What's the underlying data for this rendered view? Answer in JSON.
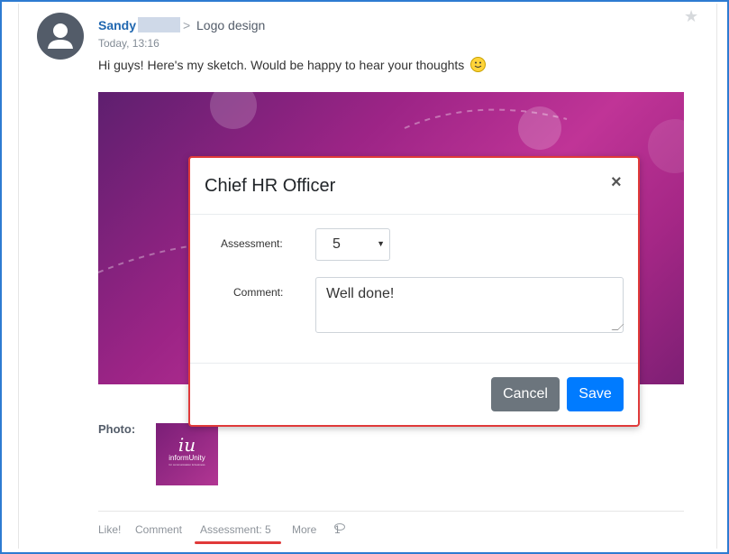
{
  "post": {
    "author": "Sandy",
    "breadcrumb_separator": ">",
    "destination": "Logo design",
    "timestamp": "Today, 13:16",
    "message": "Hi guys! Here's my sketch. Would be happy to hear your thoughts",
    "photo_label": "Photo:",
    "thumbnail": {
      "logo": "iu",
      "brand": "informUnity",
      "tagline": "for communication & business"
    }
  },
  "actions": {
    "like": "Like!",
    "comment": "Comment",
    "assessment": "Assessment: 5",
    "more": "More",
    "views": "1"
  },
  "modal": {
    "title": "Chief HR Officer",
    "close": "×",
    "assessment_label": "Assessment:",
    "assessment_value": "5",
    "comment_label": "Comment:",
    "comment_value": "Well done!",
    "cancel": "Cancel",
    "save": "Save"
  },
  "colors": {
    "author": "#2067b0",
    "frame": "#2d7bd1",
    "highlight": "#e03a3a",
    "cancel_button": "#6c757d",
    "save_button": "#007bff"
  }
}
